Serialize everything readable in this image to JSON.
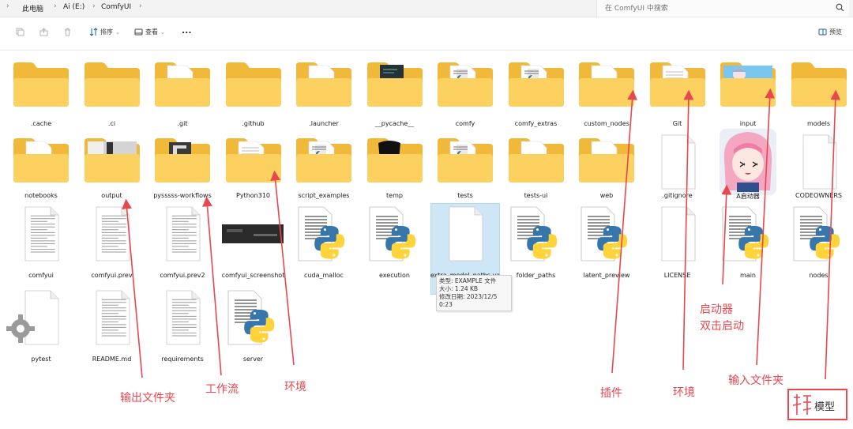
{
  "address_bar": {
    "crumbs": [
      "此电脑",
      "Ai (E:)",
      "ComfyUI"
    ],
    "search_placeholder": "在 ComfyUI 中搜索"
  },
  "toolbar": {
    "sort_label": "排序",
    "view_label": "查看",
    "more_label": "...",
    "preview_label": "预览"
  },
  "files": [
    {
      "name": ".cache",
      "type": "folder"
    },
    {
      "name": ".ci",
      "type": "folder"
    },
    {
      "name": ".git",
      "type": "folder-doc"
    },
    {
      "name": ".github",
      "type": "folder"
    },
    {
      "name": ".launcher",
      "type": "folder-doc"
    },
    {
      "name": "__pycache__",
      "type": "folder-dark"
    },
    {
      "name": "comfy",
      "type": "folder-code"
    },
    {
      "name": "comfy_extras",
      "type": "folder-code"
    },
    {
      "name": "custom_nodes",
      "type": "folder-doc"
    },
    {
      "name": "Git",
      "type": "folder-lines"
    },
    {
      "name": "input",
      "type": "folder-image"
    },
    {
      "name": "models",
      "type": "folder"
    },
    {
      "name": "notebooks",
      "type": "folder-doc"
    },
    {
      "name": "output",
      "type": "folder-photo"
    },
    {
      "name": "pysssss-workflows",
      "type": "folder-dark2"
    },
    {
      "name": "Python310",
      "type": "folder-lines"
    },
    {
      "name": "script_examples",
      "type": "folder-code"
    },
    {
      "name": "temp",
      "type": "folder-black"
    },
    {
      "name": "tests",
      "type": "folder-code"
    },
    {
      "name": "tests-ui",
      "type": "folder-doc"
    },
    {
      "name": "web",
      "type": "folder-doc"
    },
    {
      "name": ".gitignore",
      "type": "file-blank"
    },
    {
      "name": "A启动器",
      "type": "app-anime"
    },
    {
      "name": "CODEOWNERS",
      "type": "file-blank"
    },
    {
      "name": "comfyui",
      "type": "file-text"
    },
    {
      "name": "comfyui.prev",
      "type": "file-text"
    },
    {
      "name": "comfyui.prev2",
      "type": "file-text"
    },
    {
      "name": "comfyui_screenshot",
      "type": "image-dark"
    },
    {
      "name": "cuda_malloc",
      "type": "python"
    },
    {
      "name": "execution",
      "type": "python"
    },
    {
      "name": "extra_model_paths.ya",
      "type": "file-blank-selected"
    },
    {
      "name": "folder_paths",
      "type": "python"
    },
    {
      "name": "latent_preview",
      "type": "python"
    },
    {
      "name": "LICENSE",
      "type": "file-blank"
    },
    {
      "name": "main",
      "type": "python"
    },
    {
      "name": "nodes",
      "type": "python"
    },
    {
      "name": "pytest",
      "type": "file-gear"
    },
    {
      "name": "README.md",
      "type": "file-text"
    },
    {
      "name": "requirements",
      "type": "file-text"
    },
    {
      "name": "server",
      "type": "python"
    }
  ],
  "tooltip": {
    "type_line": "类型: EXAMPLE 文件",
    "size_line": "大小: 1.24 KB",
    "date_line": "修改日期: 2023/12/5 0:23"
  },
  "annotations": [
    {
      "text": "输出文件夹"
    },
    {
      "text": "工作流"
    },
    {
      "text": "环境"
    },
    {
      "text": "插件"
    },
    {
      "text": "环境"
    },
    {
      "text": "启动器"
    },
    {
      "text": "双击启动"
    },
    {
      "text": "输入文件夹"
    },
    {
      "text": "模型"
    }
  ],
  "colors": {
    "annotation": "#e8474f",
    "folder_back": "#f0b93a",
    "folder_front": "#fcd15f",
    "python_blue": "#3776ab",
    "python_yellow": "#ffd43b"
  }
}
